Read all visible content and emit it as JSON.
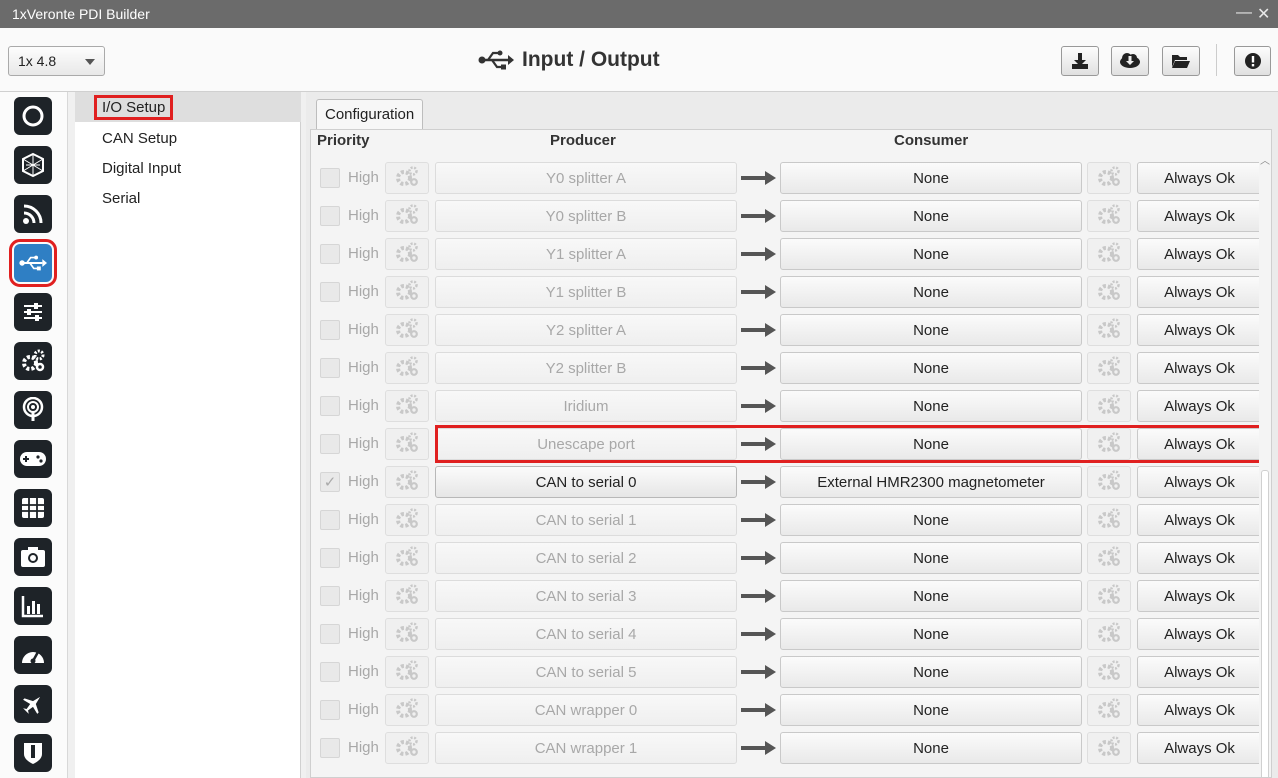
{
  "window": {
    "title": "1xVeronte PDI Builder",
    "minimize": "—",
    "close": "✕"
  },
  "toolbar": {
    "version": "1x 4.8",
    "page_title": "Input / Output"
  },
  "subnav": {
    "items": [
      {
        "label": "I/O Setup"
      },
      {
        "label": "CAN Setup"
      },
      {
        "label": "Digital Input"
      },
      {
        "label": "Serial"
      }
    ]
  },
  "tab": {
    "label": "Configuration"
  },
  "columns": {
    "priority": "Priority",
    "producer": "Producer",
    "consumer": "Consumer"
  },
  "rows": [
    {
      "priority": "High",
      "producer": "Y0 splitter A",
      "consumer": "None",
      "status": "Always Ok",
      "checked": false
    },
    {
      "priority": "High",
      "producer": "Y0 splitter B",
      "consumer": "None",
      "status": "Always Ok",
      "checked": false
    },
    {
      "priority": "High",
      "producer": "Y1 splitter A",
      "consumer": "None",
      "status": "Always Ok",
      "checked": false
    },
    {
      "priority": "High",
      "producer": "Y1 splitter B",
      "consumer": "None",
      "status": "Always Ok",
      "checked": false
    },
    {
      "priority": "High",
      "producer": "Y2 splitter A",
      "consumer": "None",
      "status": "Always Ok",
      "checked": false
    },
    {
      "priority": "High",
      "producer": "Y2 splitter B",
      "consumer": "None",
      "status": "Always Ok",
      "checked": false
    },
    {
      "priority": "High",
      "producer": "Iridium",
      "consumer": "None",
      "status": "Always Ok",
      "checked": false
    },
    {
      "priority": "High",
      "producer": "Unescape port",
      "consumer": "None",
      "status": "Always Ok",
      "checked": false
    },
    {
      "priority": "High",
      "producer": "CAN to serial 0",
      "consumer": "External HMR2300 magnetometer",
      "status": "Always Ok",
      "checked": true
    },
    {
      "priority": "High",
      "producer": "CAN to serial 1",
      "consumer": "None",
      "status": "Always Ok",
      "checked": false
    },
    {
      "priority": "High",
      "producer": "CAN to serial 2",
      "consumer": "None",
      "status": "Always Ok",
      "checked": false
    },
    {
      "priority": "High",
      "producer": "CAN to serial 3",
      "consumer": "None",
      "status": "Always Ok",
      "checked": false
    },
    {
      "priority": "High",
      "producer": "CAN to serial 4",
      "consumer": "None",
      "status": "Always Ok",
      "checked": false
    },
    {
      "priority": "High",
      "producer": "CAN to serial 5",
      "consumer": "None",
      "status": "Always Ok",
      "checked": false
    },
    {
      "priority": "High",
      "producer": "CAN wrapper 0",
      "consumer": "None",
      "status": "Always Ok",
      "checked": false
    },
    {
      "priority": "High",
      "producer": "CAN wrapper 1",
      "consumer": "None",
      "status": "Always Ok",
      "checked": false
    }
  ],
  "colors": {
    "accent": "#2f7fc4",
    "highlight": "#e02020",
    "sidebar_icon_bg": "#1e2328"
  },
  "sidebar_icons": [
    "power-icon",
    "globe-mesh-icon",
    "rss-icon",
    "usb-icon",
    "sliders-icon",
    "gears-icon",
    "broadcast-icon",
    "gamepad-icon",
    "grid-icon",
    "camera-icon",
    "bar-chart-icon",
    "gauge-icon",
    "airplane-icon",
    "shield-icon"
  ]
}
